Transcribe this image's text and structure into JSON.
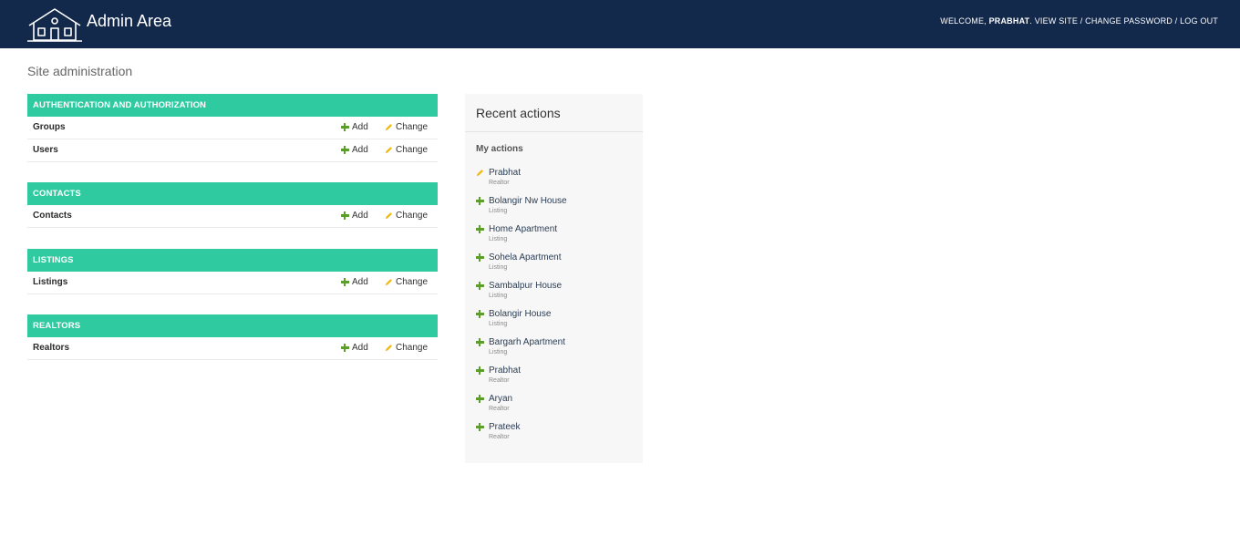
{
  "header": {
    "brand_title": "Admin Area",
    "welcome_prefix": "WELCOME,",
    "username": "PRABHAT",
    "view_site": "VIEW SITE",
    "change_password": "CHANGE PASSWORD",
    "log_out": "LOG OUT",
    "separator": " / ",
    "bg_color": "#13294b"
  },
  "page_title": "Site administration",
  "accent_color": "#30caa0",
  "modules": [
    {
      "caption": "AUTHENTICATION AND AUTHORIZATION",
      "models": [
        {
          "name": "Groups",
          "add_label": "Add",
          "change_label": "Change"
        },
        {
          "name": "Users",
          "add_label": "Add",
          "change_label": "Change"
        }
      ]
    },
    {
      "caption": "CONTACTS",
      "models": [
        {
          "name": "Contacts",
          "add_label": "Add",
          "change_label": "Change"
        }
      ]
    },
    {
      "caption": "LISTINGS",
      "models": [
        {
          "name": "Listings",
          "add_label": "Add",
          "change_label": "Change"
        }
      ]
    },
    {
      "caption": "REALTORS",
      "models": [
        {
          "name": "Realtors",
          "add_label": "Add",
          "change_label": "Change"
        }
      ]
    }
  ],
  "recent_actions": {
    "title": "Recent actions",
    "subtitle": "My actions",
    "items": [
      {
        "icon": "pencil-icon",
        "name": "Prabhat",
        "type": "Realtor"
      },
      {
        "icon": "plus-icon",
        "name": "Bolangir Nw House",
        "type": "Listing"
      },
      {
        "icon": "plus-icon",
        "name": "Home Apartment",
        "type": "Listing"
      },
      {
        "icon": "plus-icon",
        "name": "Sohela Apartment",
        "type": "Listing"
      },
      {
        "icon": "plus-icon",
        "name": "Sambalpur House",
        "type": "Listing"
      },
      {
        "icon": "plus-icon",
        "name": "Bolangir House",
        "type": "Listing"
      },
      {
        "icon": "plus-icon",
        "name": "Bargarh Apartment",
        "type": "Listing"
      },
      {
        "icon": "plus-icon",
        "name": "Prabhat",
        "type": "Realtor"
      },
      {
        "icon": "plus-icon",
        "name": "Aryan",
        "type": "Realtor"
      },
      {
        "icon": "plus-icon",
        "name": "Prateek",
        "type": "Realtor"
      }
    ]
  }
}
